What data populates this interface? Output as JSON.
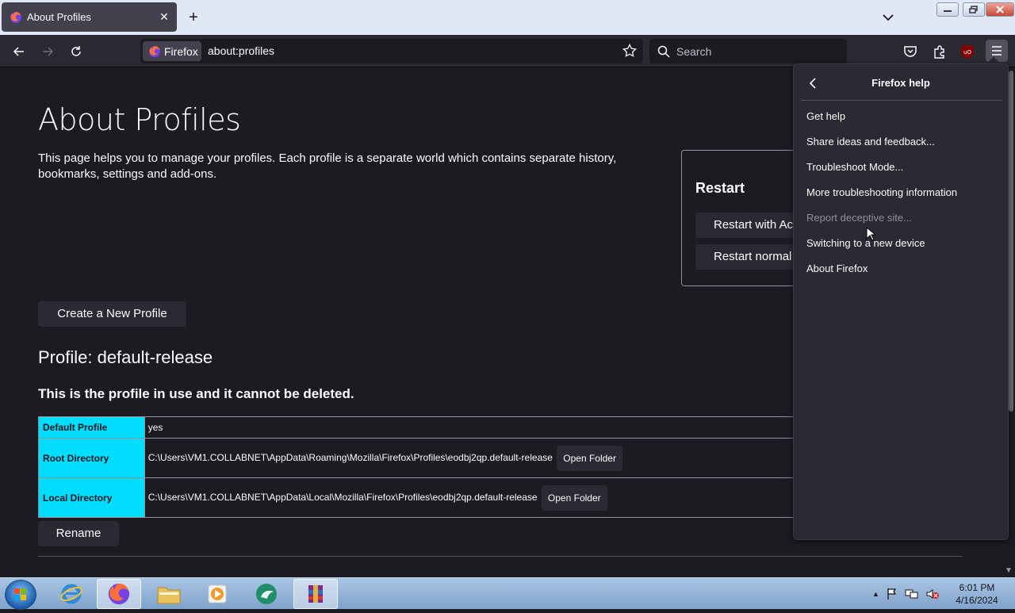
{
  "browser": {
    "tab_title": "About Profiles",
    "identity_label": "Firefox",
    "url": "about:profiles",
    "search_placeholder": "Search"
  },
  "page": {
    "title": "About Profiles",
    "intro": "This page helps you to manage your profiles. Each profile is a separate world which contains separate history, bookmarks, settings and add-ons.",
    "restart": {
      "title": "Restart",
      "with_addons_label": "Restart with Ac",
      "normally_label": "Restart normal"
    },
    "create_profile_label": "Create a New Profile",
    "profile_heading": "Profile: default-release",
    "profile_note": "This is the profile in use and it cannot be deleted.",
    "rows": [
      {
        "label": "Default Profile",
        "value": "yes"
      },
      {
        "label": "Root Directory",
        "value": "C:\\Users\\VM1.COLLABNET\\AppData\\Roaming\\Mozilla\\Firefox\\Profiles\\eodbj2qp.default-release",
        "button": "Open Folder"
      },
      {
        "label": "Local Directory",
        "value": "C:\\Users\\VM1.COLLABNET\\AppData\\Local\\Mozilla\\Firefox\\Profiles\\eodbj2qp.default-release",
        "button": "Open Folder"
      }
    ],
    "rename_label": "Rename"
  },
  "help_panel": {
    "title": "Firefox help",
    "items": [
      {
        "label": "Get help",
        "disabled": false
      },
      {
        "label": "Share ideas and feedback...",
        "disabled": false
      },
      {
        "label": "Troubleshoot Mode...",
        "disabled": false
      },
      {
        "label": "More troubleshooting information",
        "disabled": false
      },
      {
        "label": "Report deceptive site...",
        "disabled": true
      },
      {
        "label": "Switching to a new device",
        "disabled": false
      },
      {
        "label": "About Firefox",
        "disabled": false
      }
    ]
  },
  "taskbar": {
    "time": "6:01 PM",
    "date": "4/16/2024"
  },
  "colors": {
    "accent_cyan": "#00ddff",
    "page_bg": "#1c1b22",
    "panel_bg": "#2b2a33"
  }
}
